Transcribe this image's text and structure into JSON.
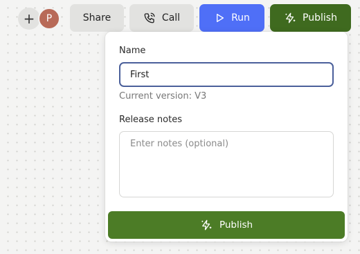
{
  "toolbar": {
    "add_symbol": "+",
    "avatar_initial": "P",
    "share_label": "Share",
    "call_label": "Call",
    "run_label": "Run",
    "publish_label": "Publish",
    "icons": [
      "plus-icon",
      "phone-icon",
      "play-icon",
      "sparkle-bolt-icon"
    ]
  },
  "popover": {
    "name_label": "Name",
    "name_value": "First",
    "version_text": "Current version: V3",
    "notes_label": "Release notes",
    "notes_placeholder": "Enter notes (optional)",
    "publish_label": "Publish"
  },
  "colors": {
    "run_button": "#4f6ff7",
    "publish_top_button": "#3f6a1f",
    "publish_main_button": "#4c7c26",
    "avatar": "#b86a58",
    "input_focus_border": "#4a5f9a"
  }
}
